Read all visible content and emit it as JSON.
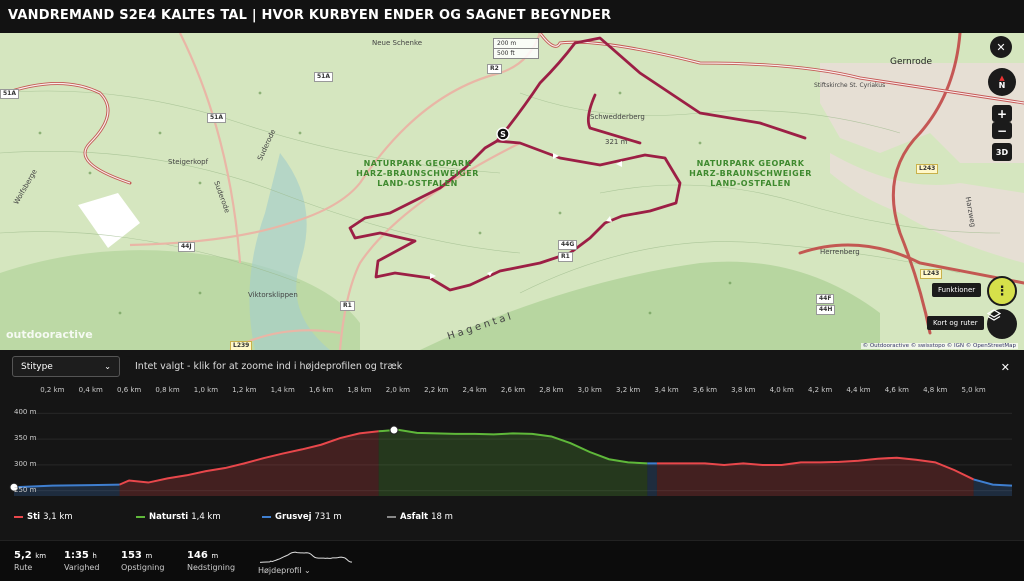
{
  "title": "VANDREMAND S2E4 KALTES TAL | HVOR KURBYEN ENDER OG SAGNET BEGYNDER",
  "map": {
    "labels": {
      "neue_schenke": "Neue Schenke",
      "steigerkopf": "Steigerkopf",
      "wolfsberge": "Wolfsberge",
      "viktorsklippen": "Viktorsklippen",
      "schwedderberg": "Schwedderberg",
      "peak": "321 m",
      "gernrode": "Gernrode",
      "stiftskirche": "Stiftskirche St. Cyriakus",
      "herrenberg": "Herrenberg",
      "hagental": "Hagental",
      "suderode_1": "Suderode",
      "suderode_2": "Suderode",
      "harzweg": "Harzweg"
    },
    "park_left": "NATURPARK GEOPARK\nHARZ-BRAUNSCHWEIGER\nLAND-OSTFALEN",
    "park_right": "NATURPARK GEOPARK\nHARZ-BRAUNSCHWEIGER\nLAND-OSTFALEN",
    "road_badges": {
      "r51a_1": "51A",
      "r51a_2": "51A",
      "r51a_3": "51A",
      "r2": "R2",
      "r1_a": "R1",
      "r1_b": "R1",
      "r44g": "44G",
      "r44j": "44J",
      "r44f": "44F",
      "r44h": "44H",
      "l239": "L239",
      "l243_a": "L243",
      "l243_b": "L243"
    },
    "scale": [
      "200 m",
      "500 ft"
    ],
    "start_marker": "S",
    "controls": {
      "close": "✕",
      "north": "N",
      "zoom_in": "+",
      "zoom_out": "−",
      "three_d": "3D",
      "functions_tip": "Funktioner",
      "layers_tip": "Kort og ruter"
    },
    "watermark": "outdooractive",
    "attribution": "© Outdooractive © swisstopo © IGN © OpenStreetMap"
  },
  "profile": {
    "select_value": "Stitype",
    "hint": "Intet valgt - klik for at zoome ind i højdeprofilen og træk",
    "close": "✕",
    "x_ticks": [
      "0,2 km",
      "0,4 km",
      "0,6 km",
      "0,8 km",
      "1,0 km",
      "1,2 km",
      "1,4 km",
      "1,6 km",
      "1,8 km",
      "2,0 km",
      "2,2 km",
      "2,4 km",
      "2,6 km",
      "2,8 km",
      "3,0 km",
      "3,2 km",
      "3,4 km",
      "3,6 km",
      "3,8 km",
      "4,0 km",
      "4,2 km",
      "4,4 km",
      "4,6 km",
      "4,8 km",
      "5,0 km"
    ],
    "y_ticks": [
      "400 m",
      "350 m",
      "300 m",
      "250 m"
    ]
  },
  "chart_data": {
    "type": "area",
    "xlabel": "",
    "ylabel": "",
    "ylim": [
      240,
      410
    ],
    "xlim": [
      0,
      5.2
    ],
    "x": [
      0,
      0.2,
      0.4,
      0.55,
      0.6,
      0.7,
      0.8,
      0.9,
      1.0,
      1.1,
      1.2,
      1.3,
      1.4,
      1.5,
      1.6,
      1.7,
      1.8,
      1.9,
      2.0,
      2.1,
      2.2,
      2.3,
      2.4,
      2.5,
      2.6,
      2.7,
      2.8,
      2.9,
      3.0,
      3.1,
      3.2,
      3.3,
      3.4,
      3.5,
      3.6,
      3.7,
      3.8,
      3.9,
      4.0,
      4.1,
      4.2,
      4.3,
      4.4,
      4.5,
      4.6,
      4.7,
      4.8,
      4.9,
      5.0,
      5.1,
      5.2
    ],
    "elevation": [
      257,
      260,
      261,
      262,
      270,
      266,
      274,
      280,
      288,
      294,
      303,
      313,
      322,
      330,
      339,
      352,
      361,
      365,
      368,
      362,
      361,
      360,
      360,
      359,
      361,
      360,
      355,
      342,
      325,
      311,
      305,
      303,
      303,
      303,
      303,
      300,
      303,
      300,
      300,
      305,
      305,
      306,
      308,
      312,
      314,
      310,
      305,
      290,
      272,
      262,
      260
    ],
    "surface_segments": [
      {
        "type": "Grusvej",
        "from": 0,
        "to": 0.55
      },
      {
        "type": "Sti",
        "from": 0.55,
        "to": 1.9
      },
      {
        "type": "Natursti",
        "from": 1.9,
        "to": 3.3
      },
      {
        "type": "Grusvej",
        "from": 3.3,
        "to": 3.35
      },
      {
        "type": "Sti",
        "from": 3.35,
        "to": 5.0
      },
      {
        "type": "Grusvej",
        "from": 5.0,
        "to": 5.2
      }
    ],
    "marker_start_km": 0,
    "marker_selected_km": 1.98,
    "legend": [
      {
        "name": "Sti",
        "value": "3,1 km",
        "color": "#e8474b"
      },
      {
        "name": "Natursti",
        "value": "1,4 km",
        "color": "#5fb83a"
      },
      {
        "name": "Grusvej",
        "value": "731 m",
        "color": "#3f7fd0"
      },
      {
        "name": "Asfalt",
        "value": "18 m",
        "color": "#888888"
      }
    ]
  },
  "stats": [
    {
      "value": "5,2",
      "unit": "km",
      "label": "Rute"
    },
    {
      "value": "1:35",
      "unit": "h",
      "label": "Varighed"
    },
    {
      "value": "153",
      "unit": "m",
      "label": "Opstigning"
    },
    {
      "value": "146",
      "unit": "m",
      "label": "Nedstigning"
    }
  ],
  "mini_profile_label": "Højdeprofil"
}
